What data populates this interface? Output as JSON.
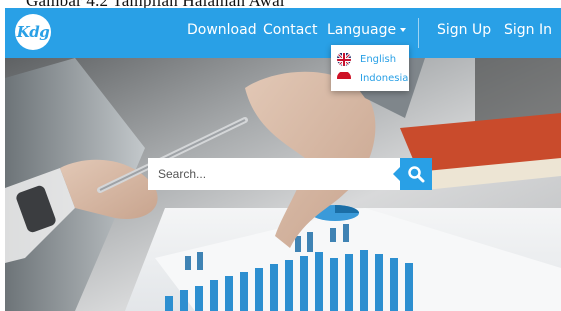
{
  "top_caption": "Gambar 4.2 Tampilan Halaman Awal",
  "brand": {
    "logo_text": "Kdg"
  },
  "nav": {
    "download": "Download",
    "contact": "Contact",
    "language": "Language",
    "sign_up": "Sign Up",
    "sign_in": "Sign In"
  },
  "language_menu": {
    "items": [
      {
        "label": "English",
        "flag": "uk-flag-icon"
      },
      {
        "label": "Indonesia",
        "flag": "indonesia-flag-icon"
      }
    ]
  },
  "search": {
    "placeholder": "Search...",
    "value": "",
    "icon": "search-icon"
  },
  "colors": {
    "accent": "#29a0e6",
    "nav_text": "#ffffff",
    "dropdown_text": "#29a0e6"
  }
}
